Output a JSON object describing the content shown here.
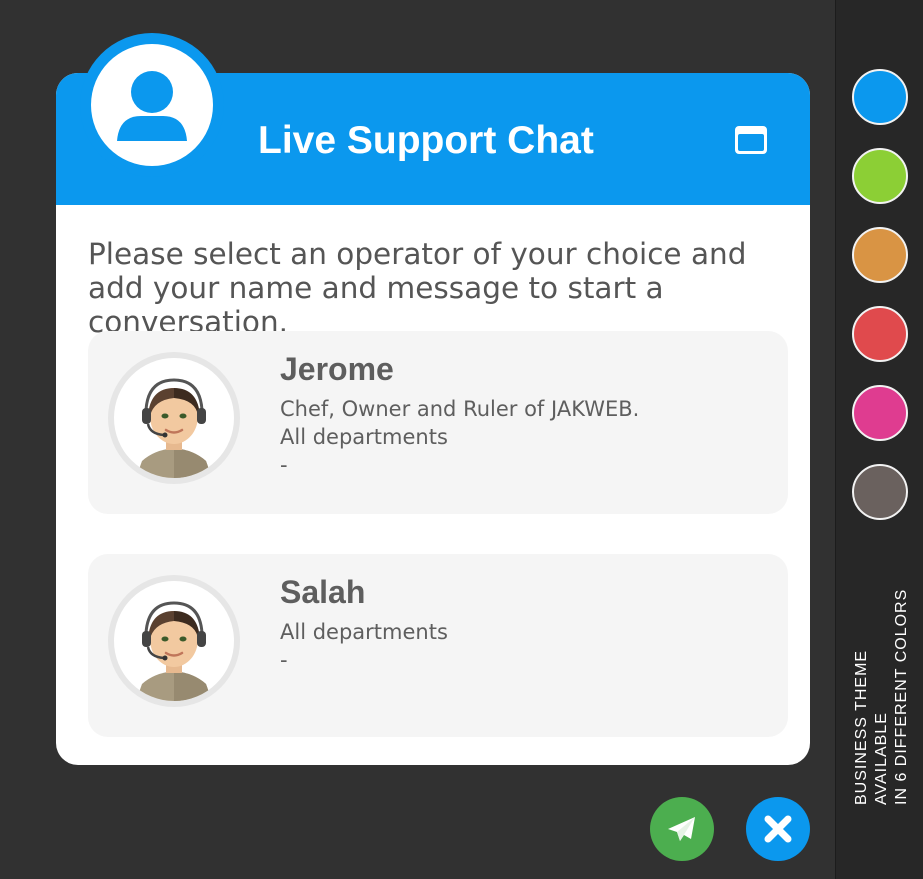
{
  "chat": {
    "title": "Live Support Chat",
    "intro": "Please select an operator of your choice and add your name and message to start a conversation.",
    "header_icon": "user-icon",
    "minimize_icon": "minimize-window-icon"
  },
  "operators": [
    {
      "name": "Jerome",
      "lines": [
        "Chef, Owner and Ruler of JAKWEB.",
        "All departments",
        "-"
      ]
    },
    {
      "name": "Salah",
      "lines": [
        "All departments",
        "-"
      ]
    }
  ],
  "actions": {
    "send_icon": "send-paper-plane-icon",
    "close_icon": "close-x-icon",
    "send_color": "#4cae4f",
    "close_color": "#0b98ee"
  },
  "sidebar": {
    "swatches": [
      {
        "name": "blue",
        "color": "#0b98ee"
      },
      {
        "name": "green",
        "color": "#8ccf35"
      },
      {
        "name": "orange",
        "color": "#d99444"
      },
      {
        "name": "red",
        "color": "#e04a4d"
      },
      {
        "name": "pink",
        "color": "#df3c90"
      },
      {
        "name": "gray",
        "color": "#6a615e"
      }
    ],
    "caption_line1": "BUSINESS THEME AVAILABLE",
    "caption_line2": "IN 6 DIFFERENT COLORS"
  },
  "colors": {
    "background": "#313131",
    "accent": "#0b98ee",
    "card": "#ffffff",
    "operator_card": "#f5f5f5"
  }
}
